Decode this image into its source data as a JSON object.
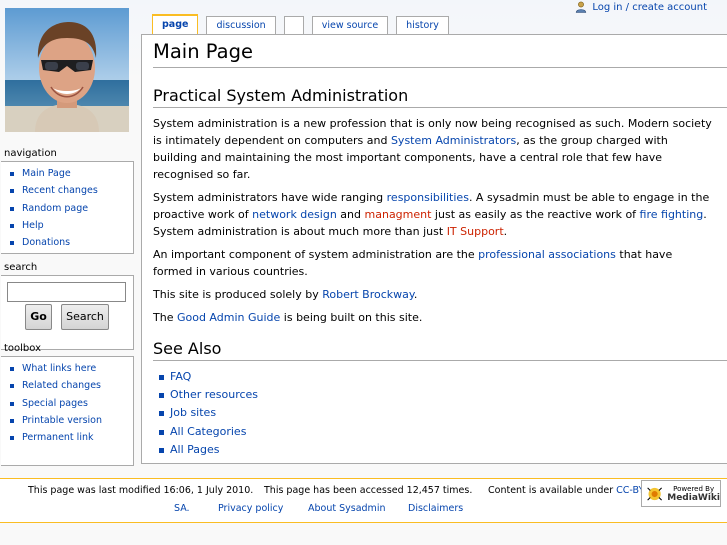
{
  "personal": {
    "login_label": "Log in / create account"
  },
  "tabs": [
    {
      "label": "page",
      "selected": true
    },
    {
      "label": "discussion",
      "selected": false
    },
    {
      "label": "",
      "selected": false
    },
    {
      "label": "view source",
      "selected": false
    },
    {
      "label": "history",
      "selected": false
    }
  ],
  "sidebar": {
    "navigation": {
      "heading": "navigation",
      "items": [
        "Main Page",
        "Recent changes",
        "Random page",
        "Help",
        "Donations"
      ]
    },
    "search": {
      "heading": "search",
      "input_value": "",
      "go_label": "Go",
      "search_label": "Search"
    },
    "toolbox": {
      "heading": "toolbox",
      "items": [
        "What links here",
        "Related changes",
        "Special pages",
        "Printable version",
        "Permanent link"
      ]
    }
  },
  "page": {
    "title": "Main Page",
    "section1_heading": "Practical System Administration",
    "p1": {
      "t1": "System administration is a new profession that is only now being recognised as such. Modern society is intimately dependent on computers and ",
      "link1": "System Administrators",
      "t2": ", as the group charged with building and maintaining the most important components, have a central role that few have recognised so far."
    },
    "p2": {
      "t1": "System administrators have wide ranging ",
      "link1": "responsibilities",
      "t2": ". A sysadmin must be able to engage in the proactive work of ",
      "link2": "network design",
      "t3": " and ",
      "link3": "managment",
      "t4": " just as easily as the reactive work of ",
      "link4": "fire fighting",
      "t5": ". System administration is about much more than just ",
      "link5": "IT Support",
      "t6": "."
    },
    "p3": {
      "t1": "An important component of system administration are the ",
      "link1": "professional associations",
      "t2": " that have formed in various countries."
    },
    "p4": {
      "t1": "This site is produced solely by ",
      "link1": "Robert Brockway",
      "t2": "."
    },
    "p5": {
      "t1": "The ",
      "link1": "Good Admin Guide",
      "t2": " is being built on this site."
    },
    "see_also_heading": "See Also",
    "see_also": [
      "FAQ",
      "Other resources",
      "Job sites",
      "All Categories",
      "All Pages"
    ]
  },
  "footer": {
    "lastmod": "This page was last modified 16:06, 1 July 2010.",
    "viewcount": "This page has been accessed 12,457 times.",
    "copyright_text": "Content is available under ",
    "copyright_link1": "CC-BY-",
    "copyright_link2": "SA.",
    "privacy": "Privacy policy",
    "about": "About Sysadmin",
    "disclaimers": "Disclaimers",
    "powered_line1": "Powered By",
    "powered_line2": "MediaWiki"
  },
  "colors": {
    "link": "#0645ad",
    "new_link": "#cc2200",
    "accent": "#fabd23",
    "border": "#aaaaaa"
  }
}
